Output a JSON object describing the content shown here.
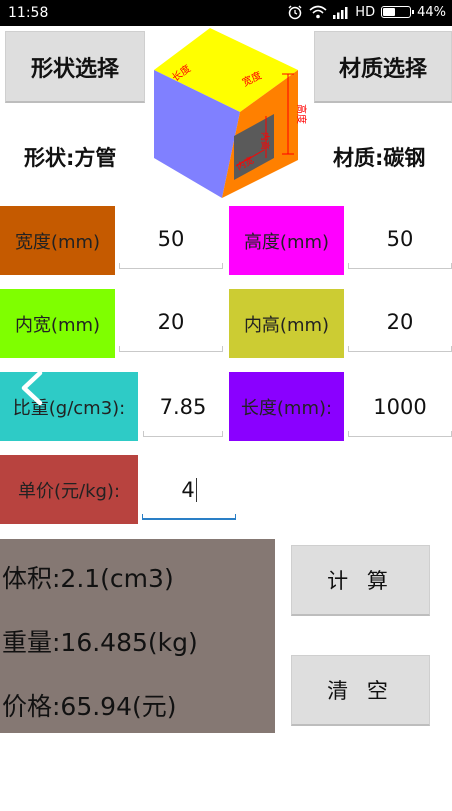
{
  "status_bar": {
    "time": "11:58",
    "network": "HD",
    "battery": "44%",
    "battery_level": 0.44
  },
  "buttons": {
    "shape_select": "形状选择",
    "material_select": "材质选择",
    "calculate": "计 算",
    "clear": "清 空"
  },
  "selection": {
    "shape": "形状:方管",
    "material": "材质:碳钢"
  },
  "diagram": {
    "length_label": "长度",
    "width_label": "宽度",
    "inner_width_label": "内宽",
    "height_label": "高度",
    "inner_height_label": "内高",
    "inner_height_label2": "内高"
  },
  "params": {
    "width": {
      "label": "宽度(mm)",
      "value": "50",
      "color": "#c55a00"
    },
    "height": {
      "label": "高度(mm)",
      "value": "50",
      "color": "#ff00ff"
    },
    "inner_width": {
      "label": "内宽(mm)",
      "value": "20",
      "color": "#7fff00"
    },
    "inner_height": {
      "label": "内高(mm)",
      "value": "20",
      "color": "#cccc33"
    },
    "density": {
      "label": "比重(g/cm3):",
      "value": "7.85",
      "color": "#2ecbc6"
    },
    "length": {
      "label": "长度(mm):",
      "value": "1000",
      "color": "#8a00ff"
    },
    "unit_price": {
      "label": "单价(元/kg):",
      "value": "4",
      "color": "#b8433f"
    }
  },
  "results": {
    "volume": "体积:2.1(cm3)",
    "weight": "重量:16.485(kg)",
    "price": "价格:65.94(元)"
  },
  "icons": {
    "back": "chevron-left-icon",
    "alarm": "alarm-icon",
    "wifi": "wifi-icon",
    "signal": "signal-icon",
    "battery": "battery-icon"
  }
}
